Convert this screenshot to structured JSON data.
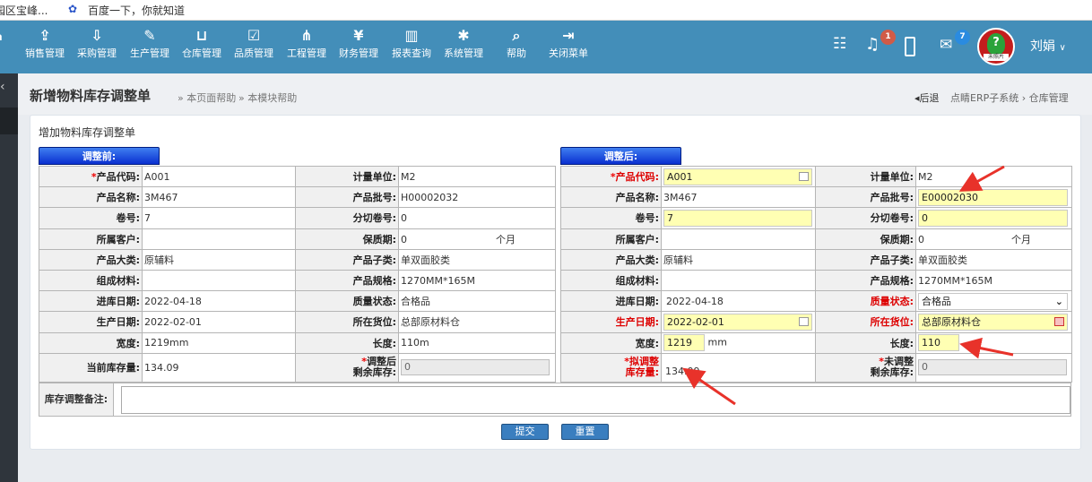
{
  "bookmarks": {
    "item1": "园区宝峰...",
    "item2": "百度一下，你就知道"
  },
  "nav": {
    "items": [
      {
        "label": "销售管理",
        "icon": "upload-icon",
        "glyph": "⇪"
      },
      {
        "label": "采购管理",
        "icon": "download-icon",
        "glyph": "⇩"
      },
      {
        "label": "生产管理",
        "icon": "wrench-icon",
        "glyph": "✎"
      },
      {
        "label": "仓库管理",
        "icon": "cart-icon",
        "glyph": "⊔"
      },
      {
        "label": "品质管理",
        "icon": "checkbox-icon",
        "glyph": "☑"
      },
      {
        "label": "工程管理",
        "icon": "sitemap-icon",
        "glyph": "⋔"
      },
      {
        "label": "财务管理",
        "icon": "yen-icon",
        "glyph": "¥"
      },
      {
        "label": "报表查询",
        "icon": "chart-icon",
        "glyph": "▥"
      },
      {
        "label": "系统管理",
        "icon": "gear-icon",
        "glyph": "✱"
      },
      {
        "label": "帮助",
        "icon": "search-icon",
        "glyph": "⌕"
      },
      {
        "label": "关闭菜单",
        "icon": "sign-out-icon",
        "glyph": "⇥"
      }
    ],
    "notify_count": "1",
    "msg_count": "7",
    "user": "刘娟",
    "avatar_text": "未照片"
  },
  "header": {
    "title": "新增物料库存调整单",
    "help1": "» 本页面帮助",
    "help2": "» 本模块帮助",
    "back": "后退",
    "crumb": "点睛ERP子系统 › 仓库管理"
  },
  "form": {
    "title": "增加物料库存调整单",
    "before_header": "调整前:",
    "after_header": "调整后:",
    "labels": {
      "product_code": "产品代码:",
      "product_name": "产品名称:",
      "roll_no": "卷号:",
      "customer": "所属客户:",
      "category": "产品大类:",
      "material": "组成材料:",
      "in_date": "进库日期:",
      "prod_date": "生产日期:",
      "width": "宽度:",
      "cur_stock": "当前库存量:",
      "unit": "计量单位:",
      "batch": "产品批号:",
      "split_roll": "分切卷号:",
      "shelf_life": "保质期:",
      "sub_category": "产品子类:",
      "spec": "产品规格:",
      "quality": "质量状态:",
      "location": "所在货位:",
      "length": "长度:",
      "adj_remaining_1": "调整后",
      "adj_remaining_2": "剩余库存:",
      "plan_qty_1": "拟调整",
      "plan_qty_2": "库存量:",
      "not_adj_1": "未调整",
      "not_adj_2": "剩余库存:"
    },
    "before": {
      "product_code": "A001",
      "product_name": "3M467",
      "roll_no": "7",
      "customer": "",
      "category": "原辅料",
      "material": "",
      "in_date": "2022-04-18",
      "prod_date": "2022-02-01",
      "width": "1219mm",
      "cur_stock": "134.09",
      "unit": "M2",
      "batch": "H00002032",
      "split_roll": "0",
      "shelf_life": "0",
      "shelf_unit": "个月",
      "sub_category": "单双面胶类",
      "spec": "1270MM*165M",
      "quality": "合格品",
      "location": "总部原材料仓",
      "length": "110m",
      "adj_remaining": "0"
    },
    "after": {
      "product_code": "A001",
      "product_name": "3M467",
      "roll_no": "7",
      "customer": "",
      "category": "原辅料",
      "material": "",
      "in_date": "2022-04-18",
      "prod_date": "2022-02-01",
      "width": "1219",
      "width_unit": "mm",
      "plan_qty": "134.09",
      "unit": "M2",
      "batch": "E00002030",
      "split_roll": "0",
      "shelf_life": "0",
      "shelf_unit": "个月",
      "sub_category": "单双面胶类",
      "spec": "1270MM*165M",
      "quality": "合格品",
      "location": "总部原材料仓",
      "length": "110",
      "not_adj_remaining": "0"
    },
    "memo_label": "库存调整备注:",
    "memo_value": "",
    "submit": "提交",
    "reset": "重置"
  },
  "colors": {
    "nav_bg": "#438eb9",
    "header_bar": "#0a2fd0",
    "input_yellow": "#ffffb3",
    "required": "#e00000",
    "arrow": "#e8322a"
  }
}
